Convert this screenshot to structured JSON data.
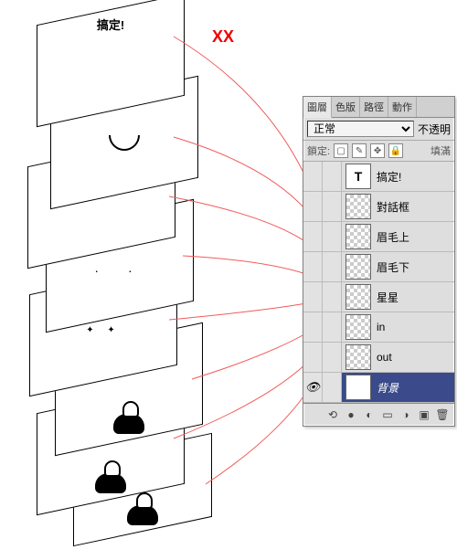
{
  "annotation": "XX",
  "stack_labels": {
    "top": "搞定!"
  },
  "panel": {
    "tabs": {
      "layers": "圖層",
      "channels": "色版",
      "paths": "路徑",
      "actions": "動作"
    },
    "blend_mode": "正常",
    "opacity_label": "不透明",
    "lock_label": "鎖定:",
    "fill_label": "填滿"
  },
  "layers": [
    {
      "name": "搞定!",
      "thumb": "T",
      "visible": false,
      "active": false,
      "checker": false
    },
    {
      "name": "對話框",
      "thumb": "",
      "visible": false,
      "active": false,
      "checker": true
    },
    {
      "name": "眉毛上",
      "thumb": "",
      "visible": false,
      "active": false,
      "checker": true
    },
    {
      "name": "眉毛下",
      "thumb": "",
      "visible": false,
      "active": false,
      "checker": true
    },
    {
      "name": "星星",
      "thumb": "",
      "visible": false,
      "active": false,
      "checker": true
    },
    {
      "name": "in",
      "thumb": "",
      "visible": false,
      "active": false,
      "checker": true
    },
    {
      "name": "out",
      "thumb": "",
      "visible": false,
      "active": false,
      "checker": true
    },
    {
      "name": "背景",
      "thumb": "",
      "visible": true,
      "active": true,
      "checker": false
    }
  ]
}
